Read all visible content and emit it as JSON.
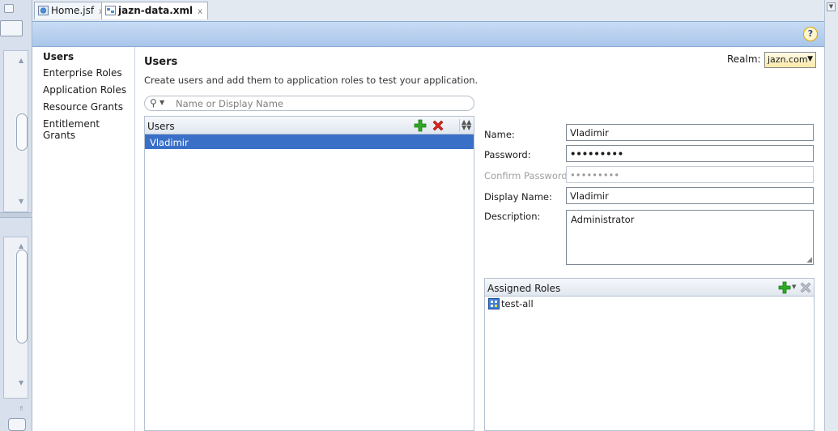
{
  "tabs": [
    {
      "label": "Home.jsf",
      "close": "x",
      "active": false
    },
    {
      "label": "jazn-data.xml",
      "close": "x",
      "active": true
    }
  ],
  "help": {
    "glyph": "?"
  },
  "nav": {
    "items": [
      {
        "label": "Users",
        "selected": true
      },
      {
        "label": "Enterprise Roles",
        "selected": false
      },
      {
        "label": "Application Roles",
        "selected": false
      },
      {
        "label": "Resource Grants",
        "selected": false
      },
      {
        "label": "Entitlement Grants",
        "selected": false
      }
    ]
  },
  "main": {
    "title": "Users",
    "description": "Create users and add them to application roles to test your application.",
    "realm": {
      "label": "Realm:",
      "value": "jazn.com"
    },
    "search": {
      "placeholder": "Name or Display Name"
    },
    "users_list": {
      "header": "Users",
      "items": [
        {
          "label": "Vladimir",
          "selected": true
        }
      ]
    },
    "form": {
      "name": {
        "label": "Name:",
        "value": "Vladimir"
      },
      "password": {
        "label": "Password:",
        "value": "•••••••••"
      },
      "confirm_password": {
        "label": "Confirm Password:",
        "value": "•••••••••"
      },
      "display_name": {
        "label": "Display Name:",
        "value": "Vladimir"
      },
      "description": {
        "label": "Description:",
        "value": "Administrator"
      }
    },
    "assigned_roles": {
      "header": "Assigned Roles",
      "items": [
        {
          "label": "test-all"
        }
      ]
    }
  },
  "colors": {
    "band": "#b5cff0",
    "selection": "#3a6fc8",
    "add_icon": "#2eaa24",
    "delete_icon": "#d8261c"
  }
}
